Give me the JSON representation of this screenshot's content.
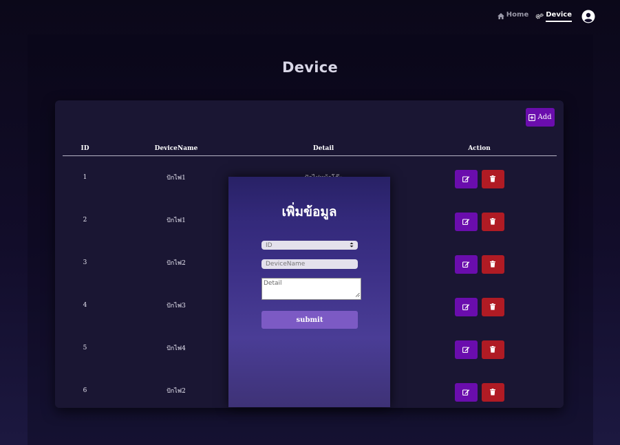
{
  "nav": {
    "home_label": "Home",
    "device_label": "Device"
  },
  "page": {
    "title": "Device"
  },
  "toolbar": {
    "add_label": "Add"
  },
  "table": {
    "headers": [
      "ID",
      "DeviceName",
      "Detail",
      "Action"
    ],
    "rows": [
      {
        "id": "1",
        "name": "ปักไฟ1",
        "detail": "ปักไฟหน้าโต๊ะ"
      },
      {
        "id": "2",
        "name": "ปักไฟ1",
        "detail": ""
      },
      {
        "id": "3",
        "name": "ปักไฟ2",
        "detail": ""
      },
      {
        "id": "4",
        "name": "ปักไฟ3",
        "detail": ""
      },
      {
        "id": "5",
        "name": "ปักไฟ4",
        "detail": ""
      },
      {
        "id": "6",
        "name": "ปักไฟ2",
        "detail": ""
      }
    ]
  },
  "modal": {
    "title": "เพิ่มข้อมูล",
    "id_placeholder": "ID",
    "name_placeholder": "DeviceName",
    "detail_placeholder": "Detail",
    "submit_label": "submit"
  },
  "colors": {
    "accent": "#6a0dad",
    "danger": "#b01b24",
    "submit": "#7c5ac4"
  },
  "icons": {
    "home": "home-icon",
    "device": "cogs-icon",
    "user": "user-circle-icon",
    "add": "plus-square-icon",
    "edit": "edit-icon",
    "delete": "trash-icon"
  }
}
